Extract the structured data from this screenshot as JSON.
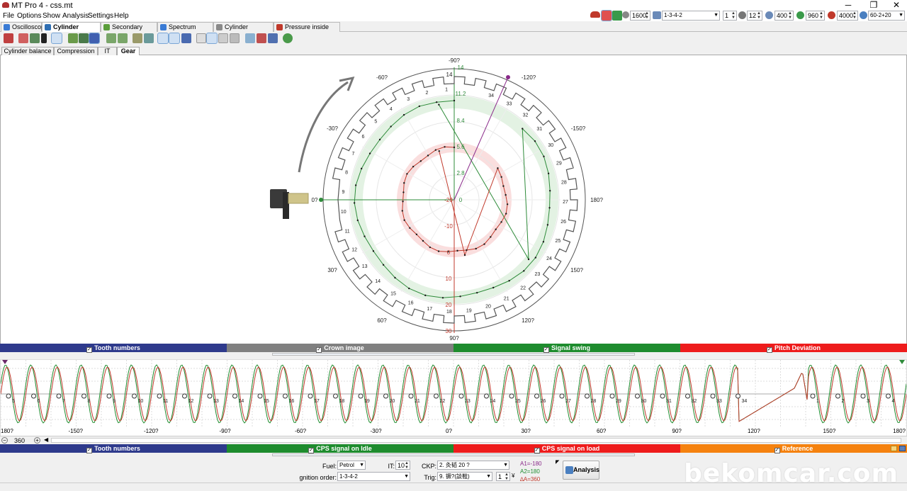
{
  "window": {
    "title": "MT Pro 4 - css.mt",
    "controls": {
      "minimize": "─",
      "maximize": "❐",
      "close": "✕"
    }
  },
  "menu": [
    "File",
    "Options",
    "Show",
    "Analysis",
    "Settings",
    "Help"
  ],
  "toolbar": {
    "rpm": "1600",
    "firing_order": "1-3-4-2",
    "cylinder": "1",
    "cyl_count": "12",
    "value_400": "400",
    "value_960": "960",
    "value_4000": "4000",
    "wheel_type": "60-2+20"
  },
  "tabs": [
    {
      "label": "Oscilloscope",
      "color": "#3a7bd5"
    },
    {
      "label": "Cylinder balance",
      "color": "#2f6fb3"
    },
    {
      "label": "Secondary voltage",
      "color": "#5b9e3b"
    },
    {
      "label": "Spectrum analyser",
      "color": "#3a7bd5"
    },
    {
      "label": "Cylinder comparison",
      "color": "#8a8a8a"
    },
    {
      "label": "Pressure inside cylinder",
      "color": "#c0392b"
    }
  ],
  "subtabs": [
    "Cylinder balance",
    "Compression",
    "IT",
    "Gear"
  ],
  "polar": {
    "angle_labels": [
      "-90?",
      "-120?",
      "-150?",
      "180?",
      "150?",
      "120?",
      "90?",
      "60?",
      "30?",
      "0?",
      "-30?",
      "-60?"
    ],
    "green_scale": [
      "14",
      "11.2",
      "8.4",
      "5.6",
      "2.8",
      "0"
    ],
    "red_scale": [
      "-20",
      "-10",
      "0",
      "10",
      "20",
      "30"
    ],
    "tooth_numbers": [
      "1",
      "2",
      "3",
      "4",
      "5",
      "6",
      "7",
      "8",
      "9",
      "10",
      "11",
      "12",
      "13",
      "14",
      "15",
      "16",
      "17",
      "18",
      "19",
      "20",
      "21",
      "22",
      "23",
      "24",
      "25",
      "26",
      "27",
      "28",
      "29",
      "30",
      "31",
      "32",
      "33",
      "34"
    ],
    "tooth_marker": "14"
  },
  "legend_top": [
    {
      "label": "Tooth numbers",
      "color": "#2e3a8c"
    },
    {
      "label": "Crown image",
      "color": "#808080"
    },
    {
      "label": "Signal swing",
      "color": "#1e8c2e"
    },
    {
      "label": "Pitch Deviation",
      "color": "#ee1c1c"
    }
  ],
  "waveform": {
    "tooth_labels": [
      "5",
      "6",
      "7",
      "8",
      "9",
      "10",
      "11",
      "12",
      "13",
      "14",
      "15",
      "16",
      "17",
      "18",
      "19",
      "20",
      "21",
      "22",
      "23",
      "24",
      "25",
      "26",
      "27",
      "28",
      "29",
      "30",
      "31",
      "32",
      "33",
      "34",
      "1",
      "2",
      "3",
      "4"
    ],
    "axis_labels": [
      "180?",
      "-150?",
      "-120?",
      "-90?",
      "-60?",
      "-30?",
      "0?",
      "30?",
      "60?",
      "90?",
      "120?",
      "150?",
      "180?"
    ],
    "zoom": "360",
    "colors": {
      "signal_idle": "#1e8c2e",
      "signal_load": "#c0392b"
    }
  },
  "legend_bottom": [
    {
      "label": "Tooth numbers",
      "color": "#2e3a8c"
    },
    {
      "label": "CPS signal on Idle",
      "color": "#1e8c2e"
    },
    {
      "label": "CPS signal on load",
      "color": "#ee1c1c"
    },
    {
      "label": "Reference",
      "color": "#f5820f"
    }
  ],
  "controls": {
    "fuel_label": "Fuel:",
    "fuel_value": "Petrol",
    "it_label": "IT:",
    "it_value": "10",
    "ignition_order_label": "gnition order:",
    "ignition_order_value": "1-3-4-2",
    "ckp_label": "CKP:",
    "ckp_value": "2. 灸韬 20 ?",
    "trig_label": "Trig:",
    "trig_value": "9. 镢?(談鞋)",
    "trig_num": "1",
    "a1": "A1=-180",
    "a2": "A2=180",
    "delta": "∆A=360",
    "analysis_button": "Analysis"
  },
  "watermark": "bekomcar.com"
}
